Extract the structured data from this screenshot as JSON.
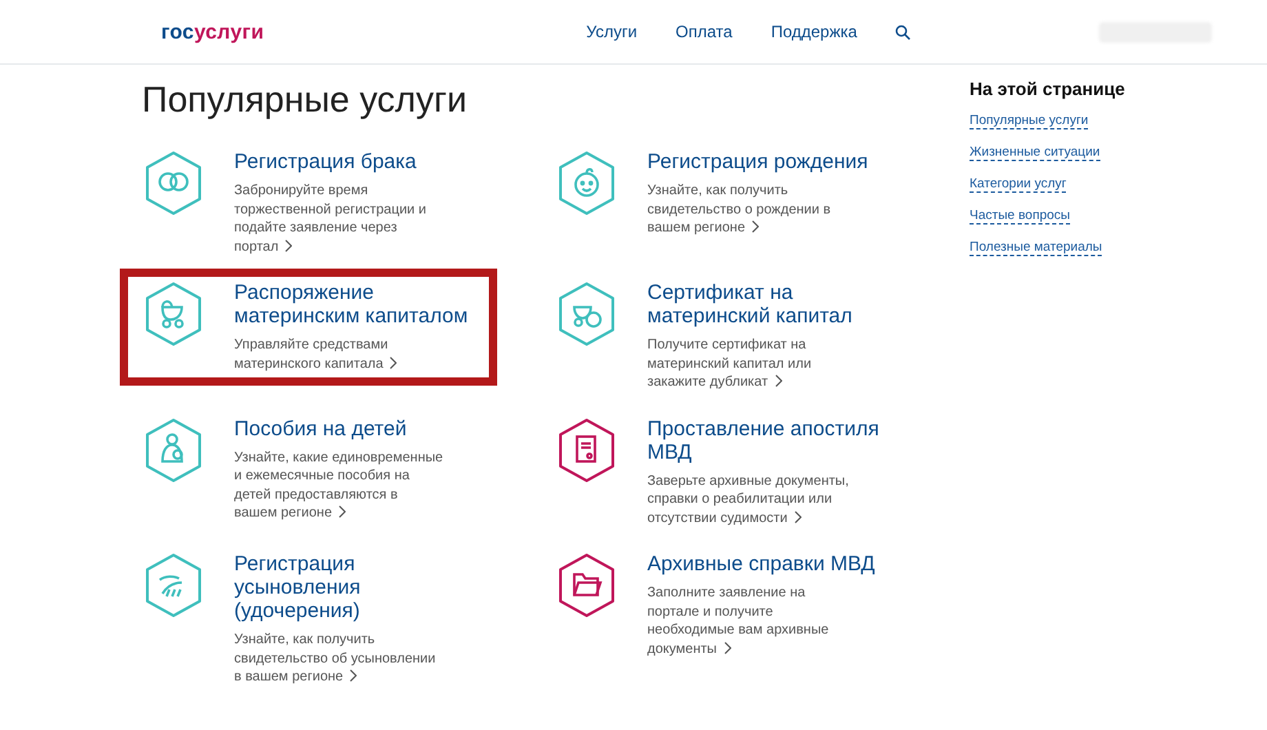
{
  "header": {
    "logo": {
      "part_1": "гос",
      "part_2": "услуги"
    },
    "nav": [
      "Услуги",
      "Оплата",
      "Поддержка"
    ],
    "user_name_blurred": true
  },
  "page_title": "Популярные услуги",
  "services": [
    {
      "title": "Регистрация брака",
      "description": "Забронируйте время торжественной регистрации и подайте заявление через портал",
      "color": "#3fbfbd",
      "highlighted": false
    },
    {
      "title": "Регистрация рождения",
      "description": "Узнайте, как получить свидетельство о рождении в вашем регионе",
      "color": "#3fbfbd",
      "highlighted": false
    },
    {
      "title": "Распоряжение материнским капиталом",
      "description": "Управляйте средствами материнского капитала",
      "color": "#3fbfbd",
      "highlighted": true
    },
    {
      "title": "Сертификат на материнский капитал",
      "description": "Получите сертификат на материнский капитал или закажите дубликат",
      "color": "#3fbfbd",
      "highlighted": false
    },
    {
      "title": "Пособия на детей",
      "description": "Узнайте, какие единовременные и ежемесячные пособия на детей предоставляются в вашем регионе",
      "color": "#3fbfbd",
      "highlighted": false
    },
    {
      "title": "Проставление апостиля МВД",
      "description": "Заверьте архивные документы, справки о реабилитации или отсутствии судимости",
      "color": "#c0165a",
      "highlighted": false
    },
    {
      "title": "Регистрация усыновления (удочерения)",
      "description": "Узнайте, как получить свидетельство об усыновлении в вашем регионе",
      "color": "#3fbfbd",
      "highlighted": false
    },
    {
      "title": "Архивные справки МВД",
      "description": "Заполните заявление на портале и получите необходимые вам архивные документы",
      "color": "#c0165a",
      "highlighted": false
    }
  ],
  "sidebar": {
    "title": "На этой странице",
    "links": [
      "Популярные услуги",
      "Жизненные ситуации",
      "Категории услуг",
      "Частые вопросы",
      "Полезные материалы"
    ]
  }
}
